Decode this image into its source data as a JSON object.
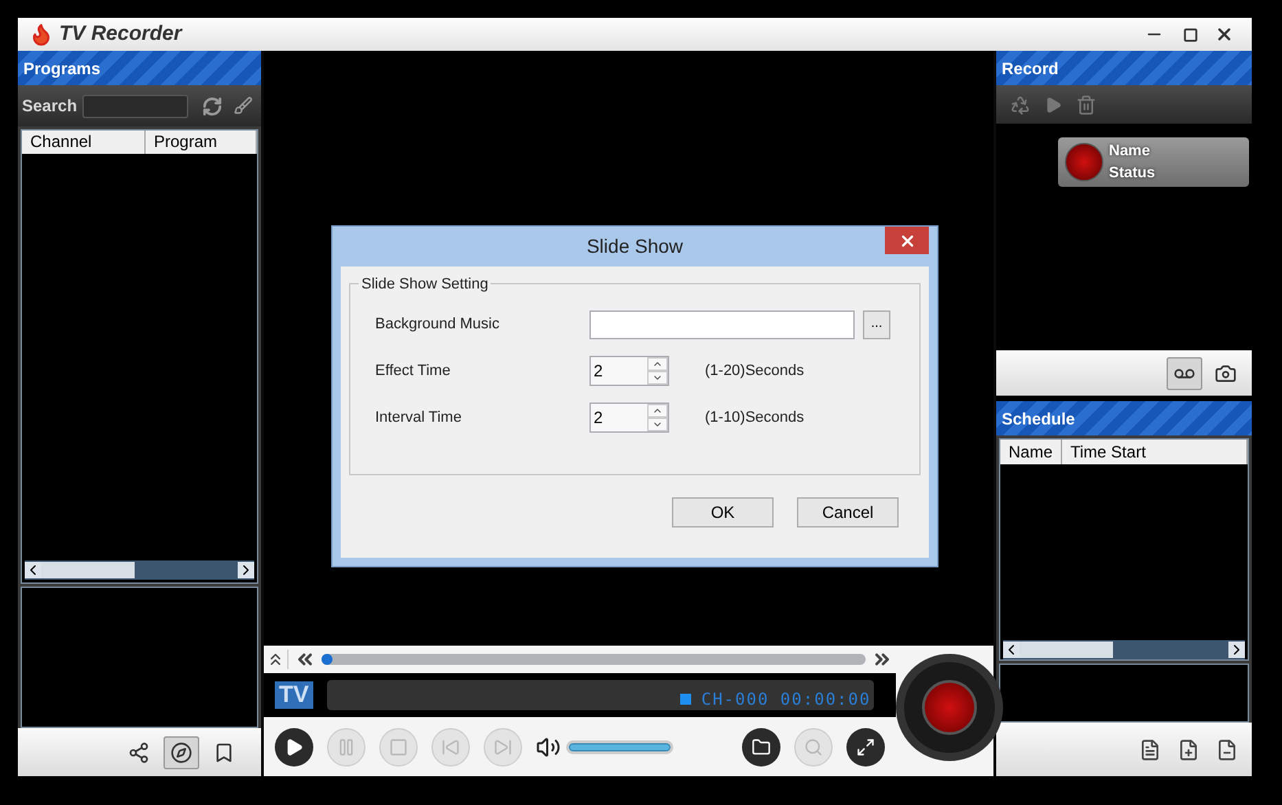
{
  "window": {
    "title": "TV Recorder"
  },
  "programs": {
    "title": "Programs",
    "search_label": "Search",
    "columns": [
      "Channel",
      "Program"
    ]
  },
  "left_tools": [
    {
      "kind": "share",
      "selected": false
    },
    {
      "kind": "compass",
      "selected": true
    },
    {
      "kind": "bookmark",
      "selected": false
    }
  ],
  "record": {
    "title": "Record",
    "card": {
      "name": "Name",
      "status": "Status"
    },
    "tools": [
      {
        "kind": "tape",
        "selected": true
      },
      {
        "kind": "camera",
        "selected": false
      }
    ]
  },
  "schedule": {
    "title": "Schedule",
    "columns": [
      "Name",
      "Time Start"
    ]
  },
  "player": {
    "tv_label": "TV",
    "display": "CH-000 00:00:00",
    "progress": {
      "level": 0.02
    },
    "volume": {
      "level": 1
    }
  },
  "dialog": {
    "title": "Slide Show",
    "group": "Slide Show Setting",
    "fields": [
      {
        "kind": "file",
        "label": "Background Music",
        "browse": "..."
      },
      {
        "kind": "spin",
        "label": "Effect Time",
        "value": "2",
        "range": "(1-20)Seconds"
      },
      {
        "kind": "spin",
        "label": "Interval Time",
        "value": "2",
        "range": "(1-10)Seconds"
      }
    ],
    "buttons": [
      "OK",
      "Cancel"
    ]
  }
}
